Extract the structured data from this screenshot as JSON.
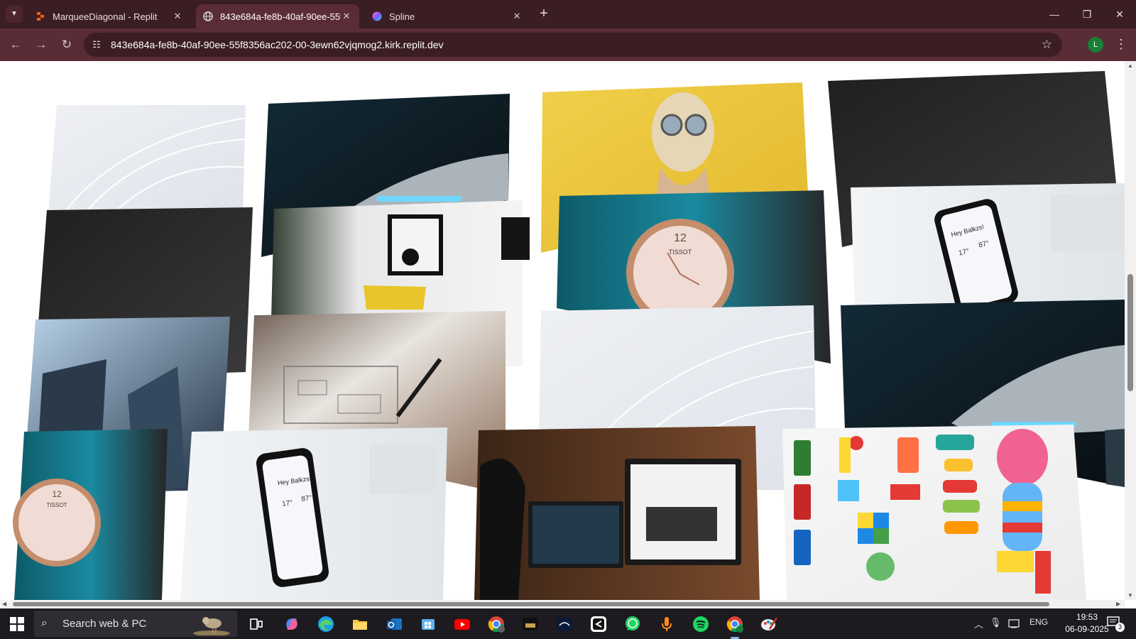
{
  "browser": {
    "tabs": [
      {
        "title": "MarqueeDiagonal - Replit",
        "active": false
      },
      {
        "title": "843e684a-fe8b-40af-90ee-55f8356ac202-00-3ewn62vjqmog2.kirk.replit.dev",
        "active": true
      },
      {
        "title": "Spline",
        "active": false
      }
    ],
    "url": "843e684a-fe8b-40af-90ee-55f8356ac202-00-3ewn62vjqmog2.kirk.replit.dev",
    "profile_initial": "L",
    "theme_color": "#3b1d24"
  },
  "page": {
    "cards": [
      {
        "image": "white wavy abstract"
      },
      {
        "image": "dark gray textured"
      },
      {
        "image": "glass skyscrapers"
      },
      {
        "image": "rose gold wristwatch"
      },
      {
        "image": "dark sports car headlight"
      },
      {
        "image": "modern living room interior"
      },
      {
        "image": "hand sketching wireframe"
      },
      {
        "image": "smartphone weather app"
      },
      {
        "image": "woman with sunglasses yellow wall"
      },
      {
        "image": "rose gold wristwatch"
      },
      {
        "image": "white wavy abstract"
      },
      {
        "image": "developer at monitors"
      },
      {
        "image": "dark gray textured"
      },
      {
        "image": "smartphone weather app"
      },
      {
        "image": "dark sports car headlight"
      },
      {
        "image": "colorful toys flat lay"
      }
    ],
    "watch_text": {
      "brand": "TISSOT",
      "hour_mark": "12"
    },
    "phone_app": {
      "greeting": "Hey Balkzs!",
      "temp": "17°",
      "temp2": "87°"
    }
  },
  "taskbar": {
    "search_placeholder": "Search web & PC",
    "language": "ENG",
    "time": "19:53",
    "date": "06-09-2025",
    "notification_count": "3",
    "apps": [
      "task-view",
      "copilot",
      "edge",
      "file-explorer",
      "outlook",
      "store",
      "youtube",
      "chrome-a",
      "sonyliv",
      "hotstar",
      "capcut",
      "whatsapp",
      "podcast",
      "spotify",
      "chrome-l",
      "replit-app"
    ]
  }
}
